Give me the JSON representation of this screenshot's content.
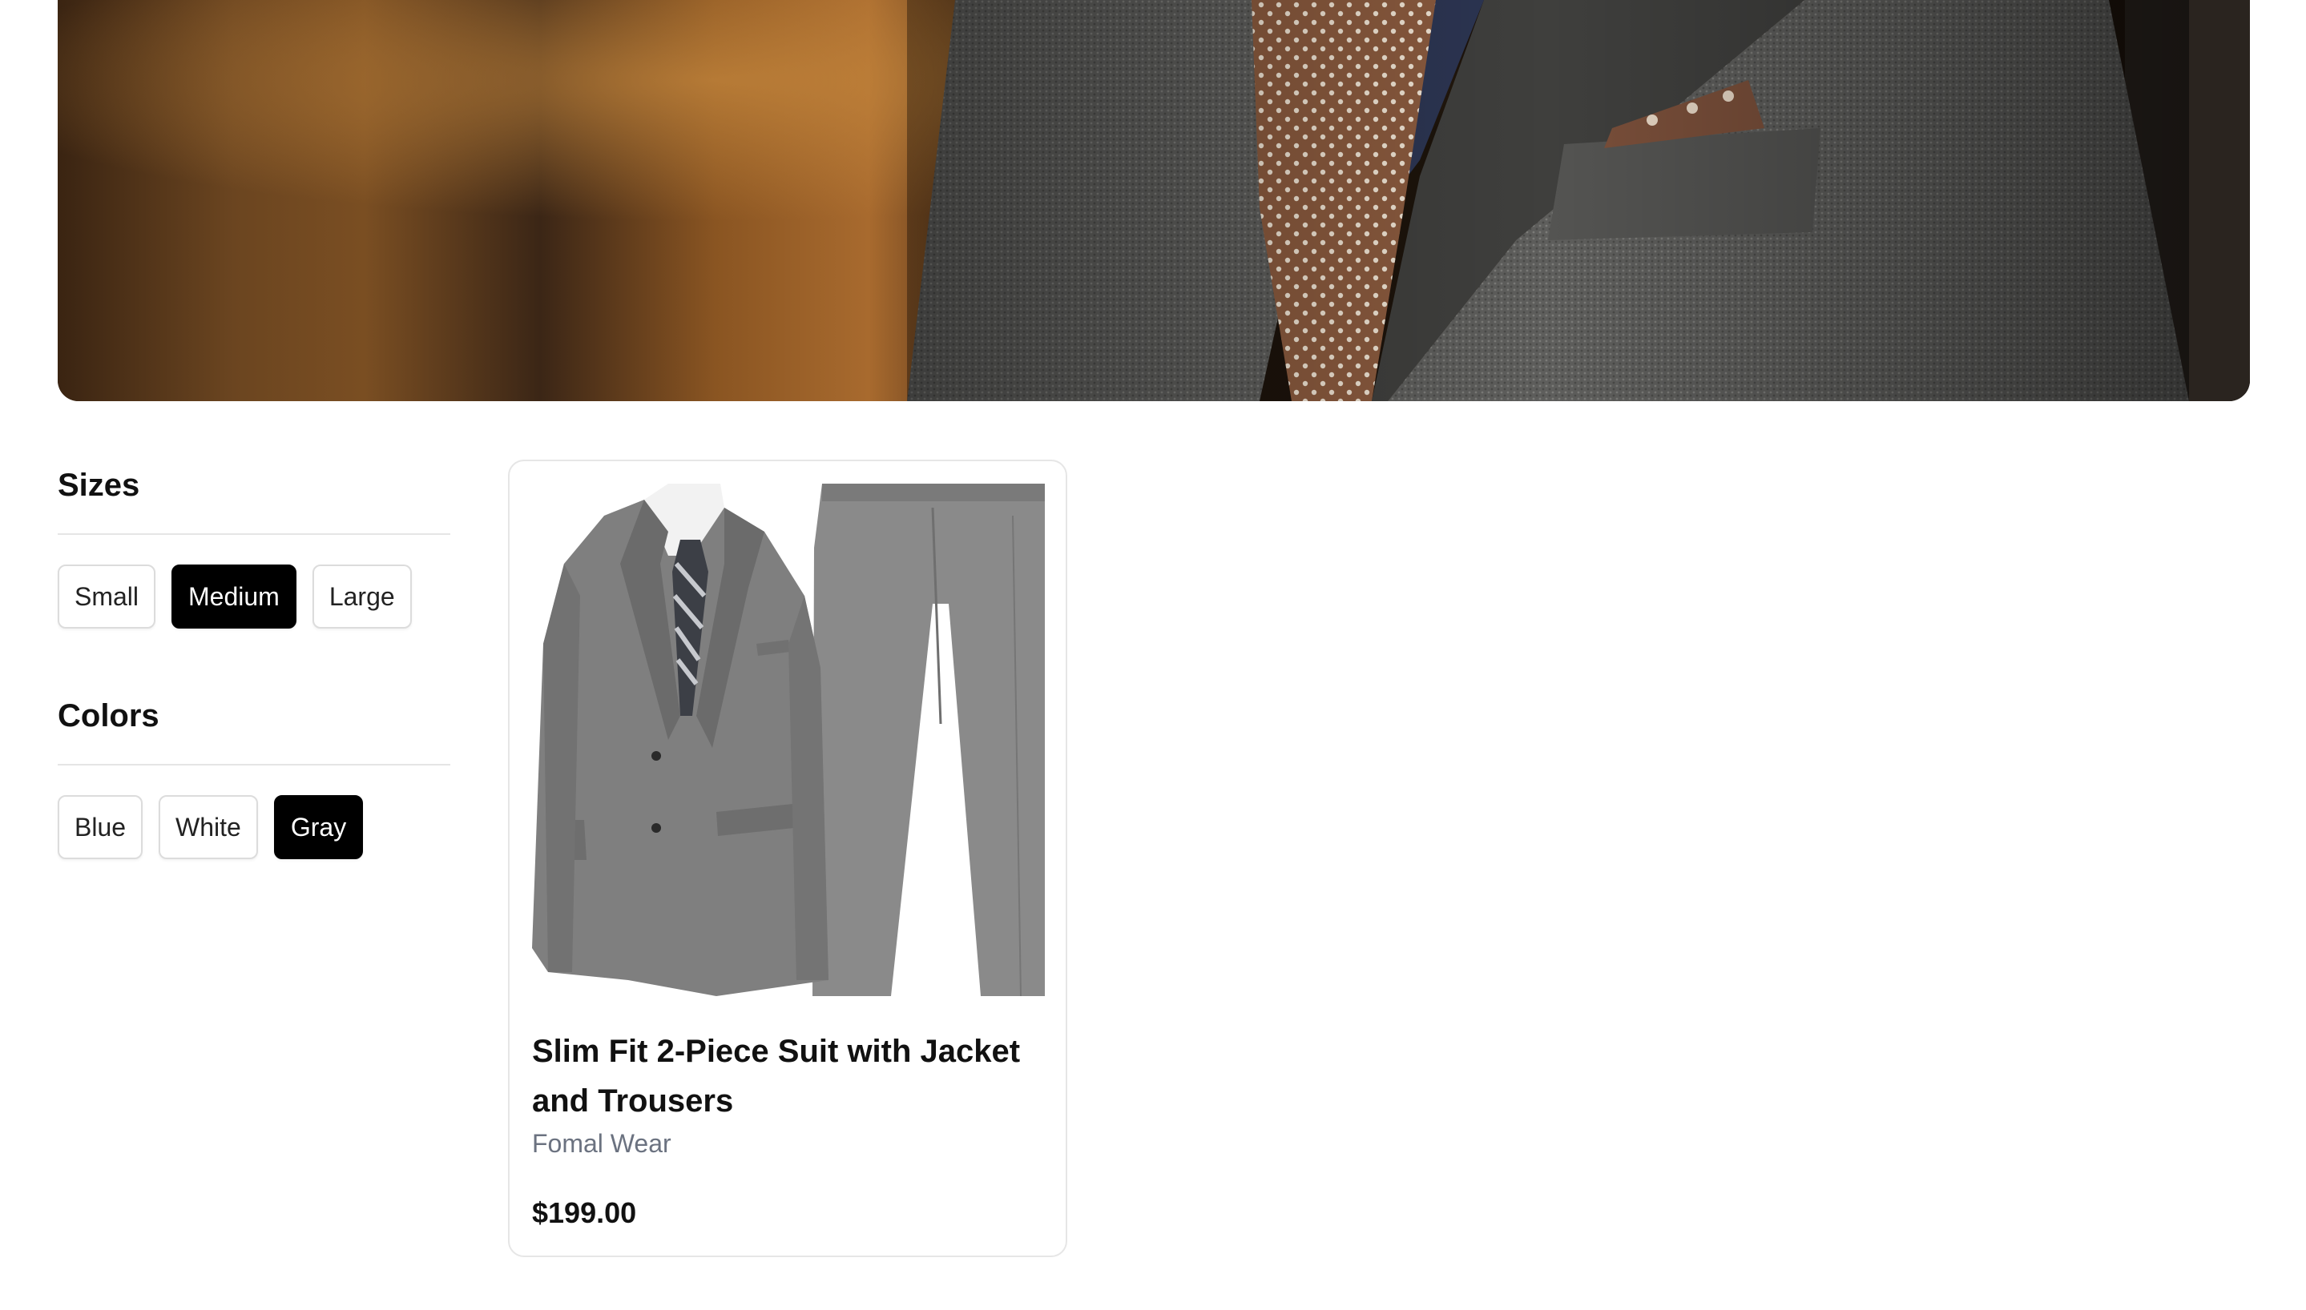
{
  "hero": {
    "image": "suit-closeup-banner"
  },
  "filters": {
    "sizes": {
      "title": "Sizes",
      "options": [
        "Small",
        "Medium",
        "Large"
      ],
      "selected": "Medium"
    },
    "colors": {
      "title": "Colors",
      "options": [
        "Blue",
        "White",
        "Gray"
      ],
      "selected": "Gray"
    }
  },
  "products": [
    {
      "name": "Slim Fit 2-Piece Suit with Jacket and Trousers",
      "brand": "Fomal Wear",
      "price": "$199.00",
      "image": "gray-suit-jacket-and-trousers"
    }
  ],
  "colors": {
    "selected_bg": "#000000",
    "selected_text": "#ffffff",
    "chip_border": "#dcdcdc",
    "brand_text": "#6b7280",
    "suit_gray": "#7d7d7d",
    "tie_brown": "#9a6b4f"
  }
}
